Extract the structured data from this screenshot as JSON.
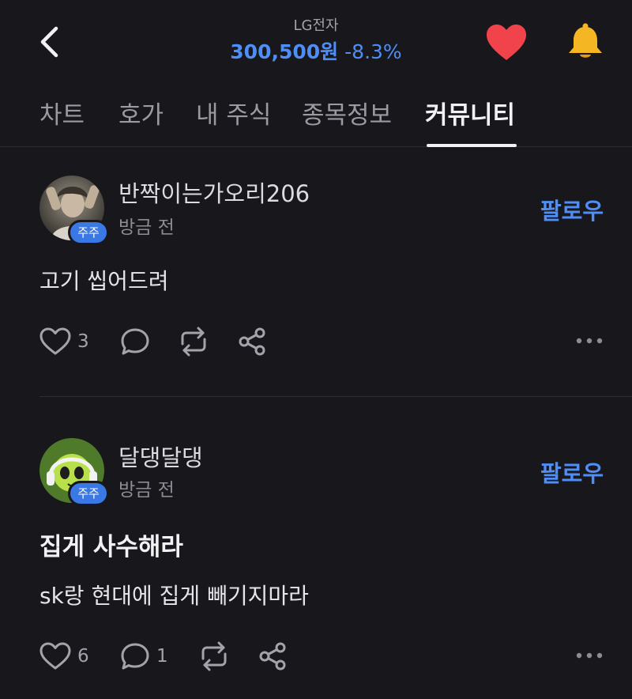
{
  "header": {
    "stock_name": "LG전자",
    "price": "300,500원",
    "change": "-8.3%"
  },
  "tabs": [
    {
      "label": "차트"
    },
    {
      "label": "호가"
    },
    {
      "label": "내 주식"
    },
    {
      "label": "종목정보"
    },
    {
      "label": "커뮤니티"
    }
  ],
  "active_tab": "커뮤니티",
  "posts": [
    {
      "author": "반짝이는가오리206",
      "badge": "주주",
      "time": "방금 전",
      "follow_label": "팔로우",
      "body": "고기 씹어드려",
      "likes": "3"
    },
    {
      "author": "달댕달댕",
      "badge": "주주",
      "time": "방금 전",
      "follow_label": "팔로우",
      "title": "집게 사수해라",
      "body": "sk랑 현대에 집게 빼기지마라",
      "likes": "6",
      "comments": "1"
    }
  ],
  "colors": {
    "background": "#17171c",
    "accent_blue": "#4f8ef7",
    "heart_red": "#f0434b",
    "bell_yellow": "#f5b623"
  }
}
